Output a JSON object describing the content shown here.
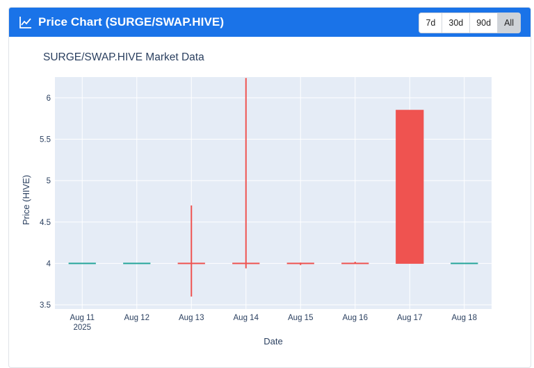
{
  "header": {
    "title": "Price Chart (SURGE/SWAP.HIVE)",
    "icon": "chart-line-icon",
    "color": "#1a73e8",
    "range_buttons": [
      "7d",
      "30d",
      "90d",
      "All"
    ],
    "active_range": "All"
  },
  "chart_data": {
    "type": "candlestick",
    "title": "SURGE/SWAP.HIVE Market Data",
    "xlabel": "Date",
    "ylabel": "Price (HIVE)",
    "categories": [
      "Aug 11",
      "Aug 12",
      "Aug 13",
      "Aug 14",
      "Aug 15",
      "Aug 16",
      "Aug 17",
      "Aug 18"
    ],
    "year_label": "2025",
    "ylim": [
      3.45,
      6.25
    ],
    "yticks": [
      3.5,
      4,
      4.5,
      5,
      5.5,
      6
    ],
    "ytick_labels": [
      "3.5",
      "4",
      "4.5",
      "5",
      "5.5",
      "6"
    ],
    "grid": true,
    "plot_bg": "#e5ecf6",
    "up_color": "#26a69a",
    "down_color": "#ef5350",
    "candles": [
      {
        "date": "Aug 11",
        "open": 4.0,
        "high": 4.0,
        "low": 4.0,
        "close": 4.0,
        "direction": "up"
      },
      {
        "date": "Aug 12",
        "open": 4.0,
        "high": 4.0,
        "low": 4.0,
        "close": 4.0,
        "direction": "up"
      },
      {
        "date": "Aug 13",
        "open": 4.0,
        "high": 4.7,
        "low": 3.6,
        "close": 4.0,
        "direction": "down"
      },
      {
        "date": "Aug 14",
        "open": 4.0,
        "high": 6.24,
        "low": 3.94,
        "close": 4.0,
        "direction": "down"
      },
      {
        "date": "Aug 15",
        "open": 4.0,
        "high": 4.01,
        "low": 3.98,
        "close": 4.0,
        "direction": "down"
      },
      {
        "date": "Aug 16",
        "open": 4.0,
        "high": 4.02,
        "low": 4.0,
        "close": 4.0,
        "direction": "down"
      },
      {
        "date": "Aug 17",
        "open": 5.85,
        "high": 5.85,
        "low": 4.0,
        "close": 4.0,
        "direction": "down"
      },
      {
        "date": "Aug 18",
        "open": 4.0,
        "high": 4.0,
        "low": 4.0,
        "close": 4.0,
        "direction": "up"
      }
    ]
  }
}
